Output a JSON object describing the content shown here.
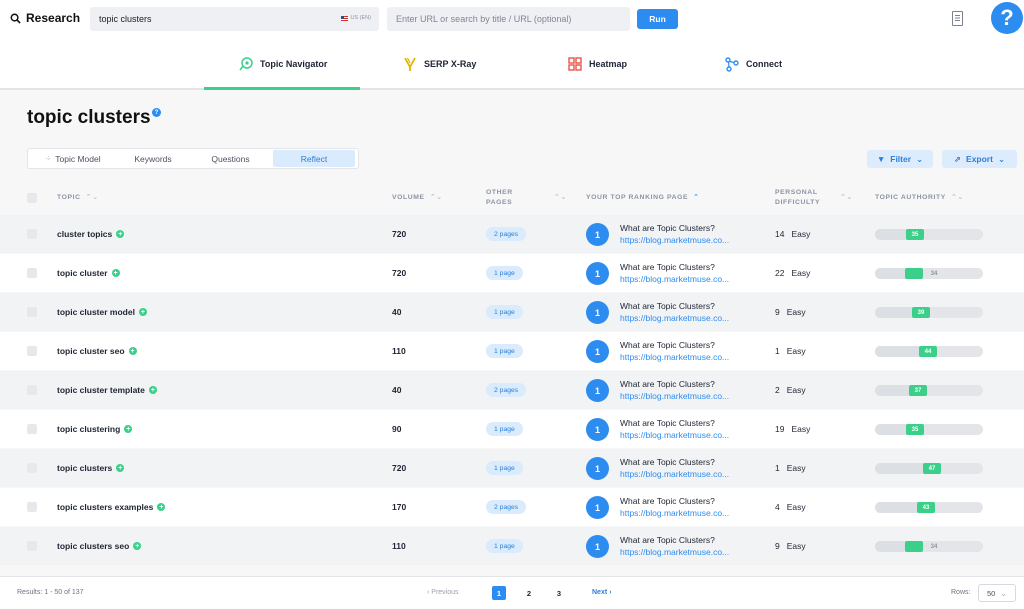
{
  "app": {
    "brand": "Research"
  },
  "search": {
    "query": "topic clusters",
    "locale": "US (EN)",
    "url_placeholder": "Enter URL or search by title / URL (optional)",
    "run_label": "Run"
  },
  "nav": {
    "tabs": [
      {
        "label": "Topic Navigator",
        "active": true
      },
      {
        "label": "SERP X-Ray"
      },
      {
        "label": "Heatmap"
      },
      {
        "label": "Connect"
      }
    ]
  },
  "page": {
    "title": "topic clusters"
  },
  "subtabs": [
    {
      "label": "Topic Model"
    },
    {
      "label": "Keywords"
    },
    {
      "label": "Questions"
    },
    {
      "label": "Reflect",
      "active": true
    }
  ],
  "toolbar": {
    "filter_label": "Filter",
    "export_label": "Export"
  },
  "table": {
    "headers": {
      "topic": "TOPIC",
      "volume": "VOLUME",
      "other_pages_1": "OTHER",
      "other_pages_2": "PAGES",
      "top_page": "YOUR TOP RANKING PAGE",
      "difficulty_1": "PERSONAL",
      "difficulty_2": "DIFFICULTY",
      "authority": "TOPIC AUTHORITY"
    },
    "rows": [
      {
        "topic": "cluster topics",
        "volume": "720",
        "pages": "2 pages",
        "rank": "1",
        "page_title": "What are Topic Clusters?",
        "page_url": "https://blog.marketmuse.co...",
        "difficulty": "14",
        "difficulty_label": "Easy",
        "authority": "35",
        "authority_value": 35
      },
      {
        "topic": "topic cluster",
        "volume": "720",
        "pages": "1 page",
        "rank": "1",
        "page_title": "What are Topic Clusters?",
        "page_url": "https://blog.marketmuse.co...",
        "difficulty": "22",
        "difficulty_label": "Easy",
        "authority": "34",
        "authority_value": 34
      },
      {
        "topic": "topic cluster model",
        "volume": "40",
        "pages": "1 page",
        "rank": "1",
        "page_title": "What are Topic Clusters?",
        "page_url": "https://blog.marketmuse.co...",
        "difficulty": "9",
        "difficulty_label": "Easy",
        "authority": "39",
        "authority_value": 39
      },
      {
        "topic": "topic cluster seo",
        "volume": "110",
        "pages": "1 page",
        "rank": "1",
        "page_title": "What are Topic Clusters?",
        "page_url": "https://blog.marketmuse.co...",
        "difficulty": "1",
        "difficulty_label": "Easy",
        "authority": "44",
        "authority_value": 44
      },
      {
        "topic": "topic cluster template",
        "volume": "40",
        "pages": "2 pages",
        "rank": "1",
        "page_title": "What are Topic Clusters?",
        "page_url": "https://blog.marketmuse.co...",
        "difficulty": "2",
        "difficulty_label": "Easy",
        "authority": "37",
        "authority_value": 37
      },
      {
        "topic": "topic clustering",
        "volume": "90",
        "pages": "1 page",
        "rank": "1",
        "page_title": "What are Topic Clusters?",
        "page_url": "https://blog.marketmuse.co...",
        "difficulty": "19",
        "difficulty_label": "Easy",
        "authority": "35",
        "authority_value": 35
      },
      {
        "topic": "topic clusters",
        "volume": "720",
        "pages": "1 page",
        "rank": "1",
        "page_title": "What are Topic Clusters?",
        "page_url": "https://blog.marketmuse.co...",
        "difficulty": "1",
        "difficulty_label": "Easy",
        "authority": "47",
        "authority_value": 47
      },
      {
        "topic": "topic clusters examples",
        "volume": "170",
        "pages": "2 pages",
        "rank": "1",
        "page_title": "What are Topic Clusters?",
        "page_url": "https://blog.marketmuse.co...",
        "difficulty": "4",
        "difficulty_label": "Easy",
        "authority": "43",
        "authority_value": 43
      },
      {
        "topic": "topic clusters seo",
        "volume": "110",
        "pages": "1 page",
        "rank": "1",
        "page_title": "What are Topic Clusters?",
        "page_url": "https://blog.marketmuse.co...",
        "difficulty": "9",
        "difficulty_label": "Easy",
        "authority": "34",
        "authority_value": 34
      }
    ]
  },
  "footer": {
    "results": "Results: 1 - 50 of 137",
    "previous": "Previous",
    "pages": [
      "1",
      "2",
      "3"
    ],
    "next": "Next",
    "rows_label": "Rows:",
    "rows_value": "50"
  },
  "colors": {
    "accent": "#2d8cf0",
    "success": "#3bd08a",
    "pill_bg": "#d9ebfc"
  }
}
